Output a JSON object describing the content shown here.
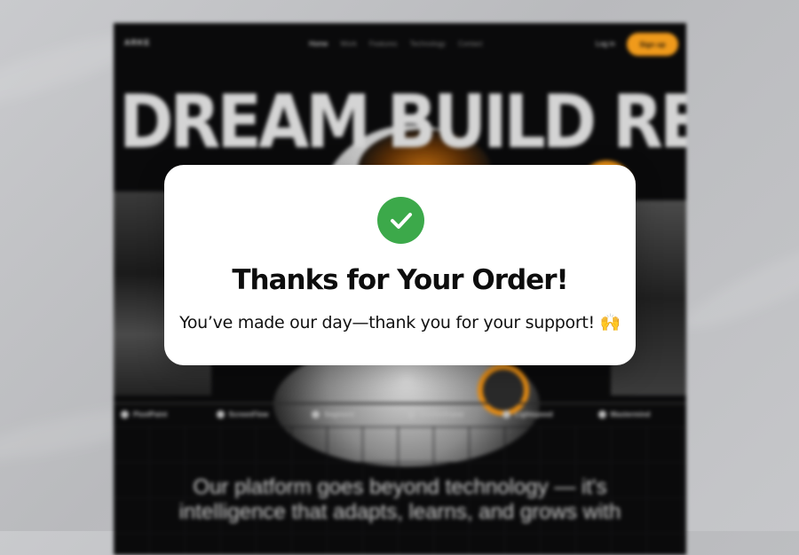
{
  "background_site": {
    "logo": "ARKE",
    "nav_links": [
      "Home",
      "Work",
      "Features",
      "Technology",
      "Contact"
    ],
    "sign_in_label": "Log in",
    "sign_up_label": "Sign up",
    "hero_title": "DREAM BUILD REALITY",
    "partners": [
      {
        "name": "PixelPaint",
        "icon": "pixelpaint-logo-icon"
      },
      {
        "name": "ScreenFlow",
        "icon": "screenflow-logo-icon"
      },
      {
        "name": "Segment",
        "icon": "segment-logo-icon"
      },
      {
        "name": "Shutterframe",
        "icon": "shutterframe-logo-icon"
      },
      {
        "name": "Lightspeed",
        "icon": "lightspeed-logo-icon"
      },
      {
        "name": "Mastermind",
        "icon": "mastermind-logo-icon"
      }
    ],
    "tagline": "Our platform goes beyond technology — it's intelligence that adapts, learns, and grows with"
  },
  "modal": {
    "icon": "check-circle-icon",
    "title": "Thanks for Your Order!",
    "message": "You’ve made our day—thank you for your support! 🙌"
  },
  "colors": {
    "accent": "#f09a1b",
    "success": "#3ca94a",
    "modal_bg": "#ffffff"
  }
}
